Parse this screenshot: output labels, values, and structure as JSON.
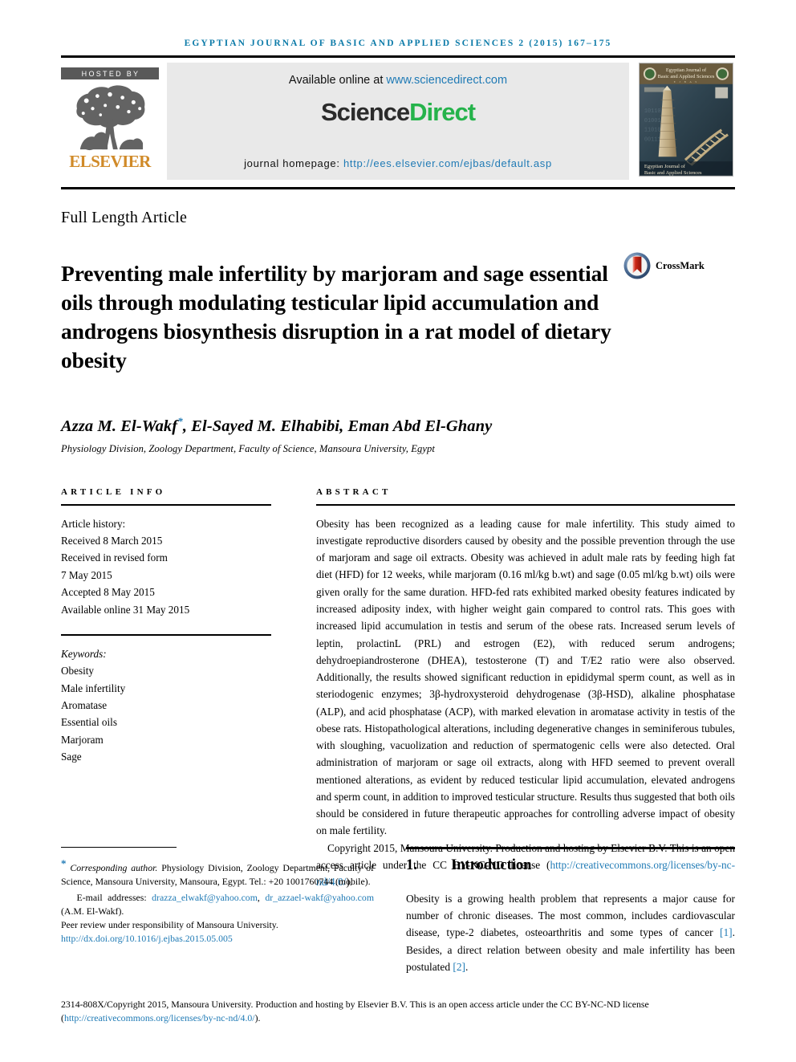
{
  "running_head": "EGYPTIAN JOURNAL OF BASIC AND APPLIED SCIENCES 2 (2015) 167–175",
  "masthead": {
    "hosted_by": "HOSTED BY",
    "publisher": "ELSEVIER",
    "available_text": "Available online at ",
    "available_link": "www.sciencedirect.com",
    "logo_part1": "Science",
    "logo_part2": "Direct",
    "homepage_label": "journal homepage: ",
    "homepage_link": "http://ees.elsevier.com/ejbas/default.asp",
    "cover_title_line1": "Egyptian Journal of",
    "cover_title_line2": "Basic and Applied Sciences",
    "cover_footer_line1": "Egyptian Journal of",
    "cover_footer_line2": "Basic and Applied Sciences"
  },
  "article_type": "Full Length Article",
  "title": "Preventing male infertility by marjoram and sage essential oils through modulating testicular lipid accumulation and androgens biosynthesis disruption in a rat model of dietary obesity",
  "crossmark_label": "CrossMark",
  "authors": "Azza M. El-Wakf",
  "authors_rest": ", El-Sayed M. Elhabibi, Eman Abd El-Ghany",
  "author_marker": "*",
  "affiliation": "Physiology Division, Zoology Department, Faculty of Science, Mansoura University, Egypt",
  "article_info": {
    "heading": "ARTICLE INFO",
    "history_label": "Article history:",
    "history": [
      "Received 8 March 2015",
      "Received in revised form",
      "7 May 2015",
      "Accepted 8 May 2015",
      "Available online 31 May 2015"
    ],
    "keywords_label": "Keywords:",
    "keywords": [
      "Obesity",
      "Male infertility",
      "Aromatase",
      "Essential oils",
      "Marjoram",
      "Sage"
    ]
  },
  "abstract": {
    "heading": "ABSTRACT",
    "paragraph1": "Obesity has been recognized as a leading cause for male infertility. This study aimed to investigate reproductive disorders caused by obesity and the possible prevention through the use of marjoram and sage oil extracts. Obesity was achieved in adult male rats by feeding high fat diet (HFD) for 12 weeks, while marjoram (0.16 ml/kg b.wt) and sage (0.05 ml/kg b.wt) oils were given orally for the same duration. HFD-fed rats exhibited marked obesity features indicated by increased adiposity index, with higher weight gain compared to control rats. This goes with increased lipid accumulation in testis and serum of the obese rats. Increased serum levels of leptin, prolactinL (PRL) and estrogen (E2), with reduced serum androgens; dehydroepiandrosterone (DHEA), testosterone (T) and T/E2 ratio were also observed. Additionally, the results showed significant reduction in epididymal sperm count, as well as in steriodogenic enzymes; 3β-hydroxysteroid dehydrogenase (3β-HSD), alkaline phosphatase (ALP), and acid phosphatase (ACP), with marked elevation in aromatase activity in testis of the obese rats. Histopathological alterations, including degenerative changes in seminiferous tubules, with sloughing, vacuolization and reduction of spermatogenic cells were also detected. Oral administration of marjoram or sage oil extracts, along with HFD seemed to prevent overall mentioned alterations, as evident by reduced testicular lipid accumulation, elevated androgens and sperm count, in addition to improved testicular structure. Results thus suggested that both oils should be considered in future therapeutic approaches for controlling adverse impact of obesity on male fertility.",
    "copyright_text": "Copyright 2015, Mansoura University. Production and hosting by Elsevier B.V. This is an open access article under the CC BY-NC-ND license (",
    "copyright_link": "http://creativecommons.org/licenses/by-nc-nd/4.0/",
    "copyright_close": ")."
  },
  "introduction": {
    "number": "1.",
    "heading": "Introduction",
    "text_part1": "Obesity is a growing health problem that represents a major cause for number of chronic diseases. The most common, includes cardiovascular disease, type-2 diabetes, osteoarthritis and some types of cancer ",
    "ref1": "[1]",
    "text_part2": ". Besides, a direct relation between obesity and male infertility has been postulated ",
    "ref2": "[2]",
    "text_part3": "."
  },
  "footnotes": {
    "corresponding_marker": "*",
    "corresponding_label": "Corresponding author.",
    "corresponding_text": " Physiology Division, Zoology Department, Faculty of Science, Mansoura University, Mansoura, Egypt. Tel.: +20 1001760744 (mobile).",
    "email_label": "E-mail addresses: ",
    "email1": "drazza_elwakf@yahoo.com",
    "email_sep": ", ",
    "email2": "dr_azzael-wakf@yahoo.com",
    "email_attrib": " (A.M. El-Wakf).",
    "peer_review": "Peer review under responsibility of Mansoura University.",
    "doi": "http://dx.doi.org/10.1016/j.ejbas.2015.05.005"
  },
  "bottom_copyright": {
    "text_before": "2314-808X/Copyright 2015, Mansoura University. Production and hosting by Elsevier B.V. This is an open access article under the CC BY-NC-ND license (",
    "link": "http://creativecommons.org/licenses/by-nc-nd/4.0/",
    "text_after": ")."
  },
  "colors": {
    "link": "#1f7ab5",
    "running_head": "#0b7aa8",
    "elsevier_orange": "#d08a28",
    "sciencedirect_green": "#25b34b",
    "panel_gray": "#e9e9e9"
  }
}
